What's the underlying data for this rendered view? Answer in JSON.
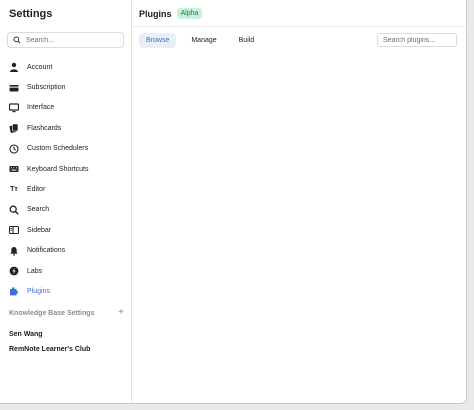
{
  "sidebar": {
    "title": "Settings",
    "search_placeholder": "Search...",
    "items": [
      {
        "label": "Account",
        "icon": "person-icon"
      },
      {
        "label": "Subscription",
        "icon": "credit-card-icon"
      },
      {
        "label": "Interface",
        "icon": "monitor-icon"
      },
      {
        "label": "Flashcards",
        "icon": "flashcards-icon"
      },
      {
        "label": "Custom Schedulers",
        "icon": "clock-icon"
      },
      {
        "label": "Keyboard Shortcuts",
        "icon": "keyboard-icon"
      },
      {
        "label": "Editor",
        "icon": "text-format-icon",
        "glyph": "Tт"
      },
      {
        "label": "Search",
        "icon": "search-icon"
      },
      {
        "label": "Sidebar",
        "icon": "sidebar-icon"
      },
      {
        "label": "Notifications",
        "icon": "bell-icon"
      },
      {
        "label": "Labs",
        "icon": "labs-icon"
      },
      {
        "label": "Plugins",
        "icon": "puzzle-icon",
        "active": true
      }
    ],
    "kb_section_label": "Knowledge Base Settings",
    "kb_add_label": "+",
    "workspaces": [
      "Sen Wang",
      "RemNote Learner's Club"
    ]
  },
  "main": {
    "title": "Plugins",
    "badge": "Alpha",
    "tabs": [
      {
        "label": "Browse",
        "active": true
      },
      {
        "label": "Manage"
      },
      {
        "label": "Build"
      }
    ],
    "search_placeholder": "Search plugins..."
  },
  "colors": {
    "accent": "#3d6fd6",
    "badge_bg": "#c9f2dc",
    "badge_text": "#1f7a48",
    "muted": "#8b8b92"
  }
}
